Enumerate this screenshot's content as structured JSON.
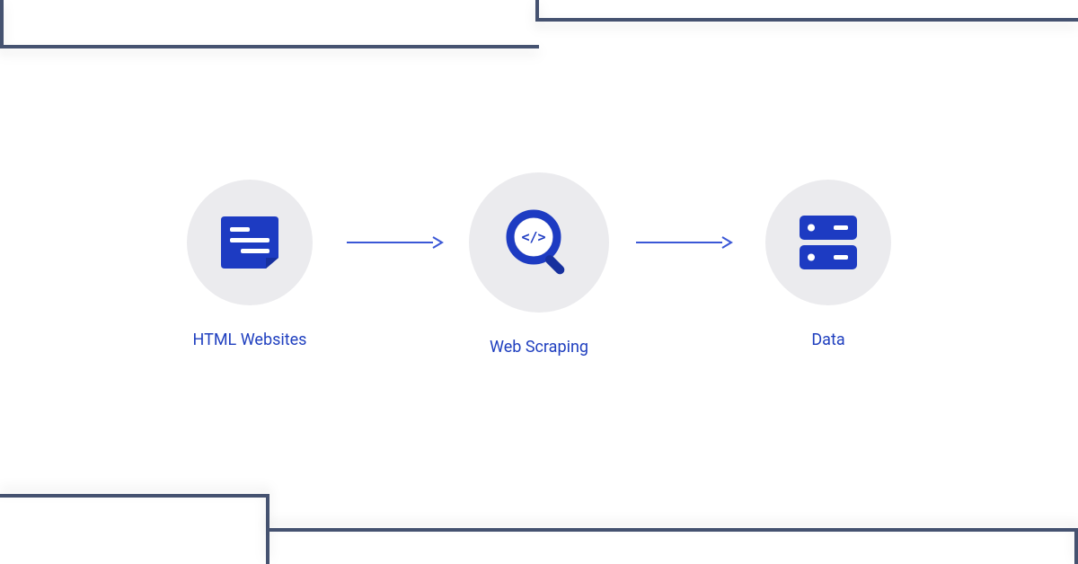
{
  "colors": {
    "accent": "#1d3bc2",
    "accent_dark": "#17309e",
    "circle_bg": "#ebebee",
    "frame": "#455270",
    "label": "#1f3fbf"
  },
  "steps": [
    {
      "id": "html-websites",
      "label": "HTML Websites",
      "icon": "document-icon"
    },
    {
      "id": "web-scraping",
      "label": "Web Scraping",
      "icon": "code-magnifier-icon"
    },
    {
      "id": "data",
      "label": "Data",
      "icon": "server-icon"
    }
  ],
  "arrows_between": 2
}
